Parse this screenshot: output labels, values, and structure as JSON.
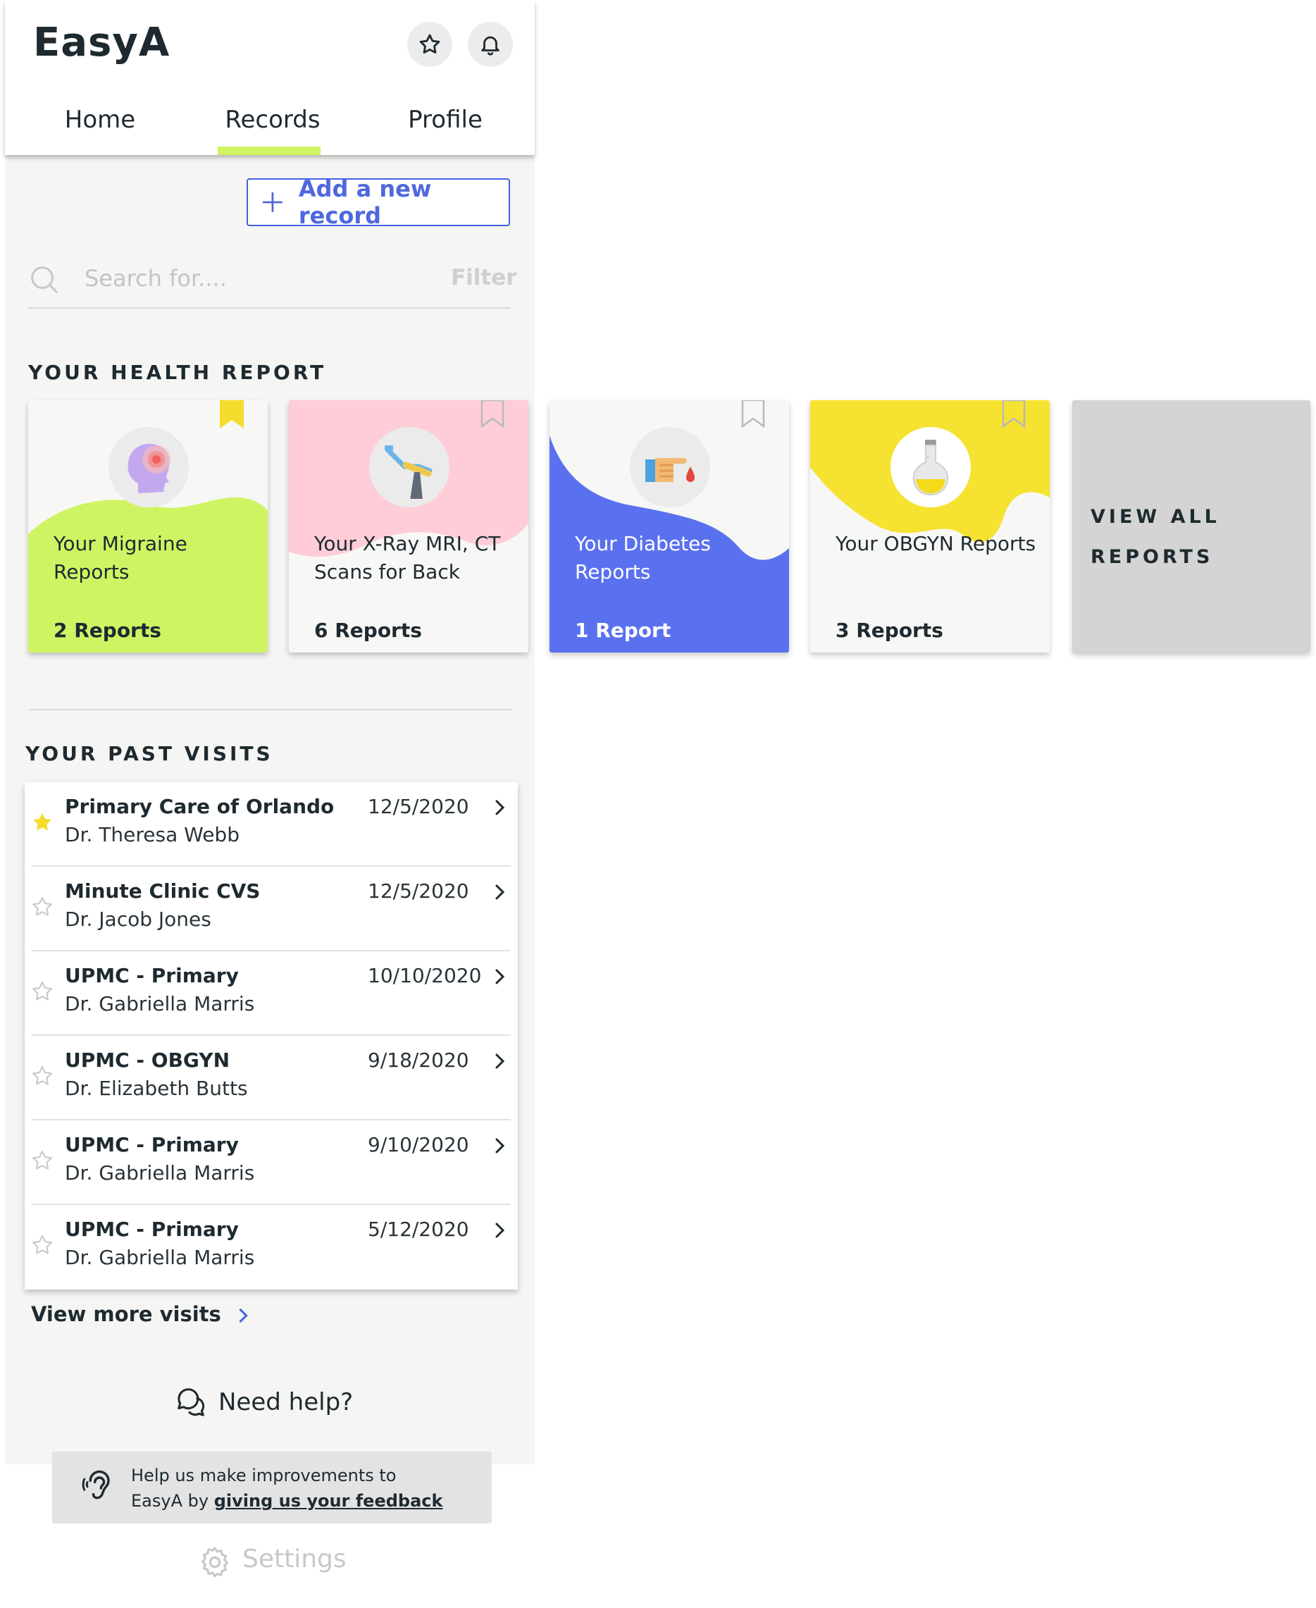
{
  "app": {
    "brand": "EasyA"
  },
  "header": {
    "tabs": [
      {
        "label": "Home"
      },
      {
        "label": "Records"
      },
      {
        "label": "Profile"
      }
    ],
    "active_tab": "Records",
    "accent": "#d0f463"
  },
  "actions": {
    "add_record_label": "Add a new record"
  },
  "search": {
    "placeholder": "Search for....",
    "filter_label": "Filter"
  },
  "health_report": {
    "title": "YOUR HEALTH REPORT",
    "cards": [
      {
        "label": "Your Migraine Reports",
        "count": "2 Reports",
        "bookmarked": true,
        "icon": "brain-icon",
        "color": "#cff463"
      },
      {
        "label": "Your X-Ray MRI, CT Scans for Back",
        "count": "6 Reports",
        "bookmarked": false,
        "icon": "xray-machine-icon",
        "color": "#ffcdd7"
      },
      {
        "label": "Your Diabetes Reports",
        "count": "1 Report",
        "bookmarked": false,
        "icon": "finger-blood-drop-icon",
        "color": "#5a71ef"
      },
      {
        "label": "Your OBGYN Reports",
        "count": "3 Reports",
        "bookmarked": false,
        "icon": "flask-icon",
        "color": "#f6e231"
      }
    ],
    "view_all_line1": "VIEW ALL",
    "view_all_line2": "REPORTS"
  },
  "past_visits": {
    "title": "YOUR PAST VISITS",
    "items": [
      {
        "name": "Primary Care of Orlando",
        "doctor": "Dr. Theresa Webb",
        "date": "12/5/2020",
        "starred": true
      },
      {
        "name": "Minute Clinic CVS",
        "doctor": "Dr. Jacob Jones",
        "date": "12/5/2020",
        "starred": false
      },
      {
        "name": "UPMC - Primary",
        "doctor": "Dr. Gabriella Marris",
        "date": "10/10/2020",
        "starred": false
      },
      {
        "name": "UPMC - OBGYN",
        "doctor": "Dr. Elizabeth Butts",
        "date": "9/18/2020",
        "starred": false
      },
      {
        "name": "UPMC - Primary",
        "doctor": "Dr. Gabriella Marris",
        "date": "9/10/2020",
        "starred": false
      },
      {
        "name": "UPMC - Primary",
        "doctor": "Dr. Gabriella Marris",
        "date": "5/12/2020",
        "starred": false
      }
    ],
    "view_more_label": "View more visits"
  },
  "help": {
    "label": "Need help?"
  },
  "feedback": {
    "line1": "Help us make improvements to",
    "prefix": "EasyA by ",
    "link": "giving us your feedback"
  },
  "settings": {
    "label": "Settings"
  }
}
